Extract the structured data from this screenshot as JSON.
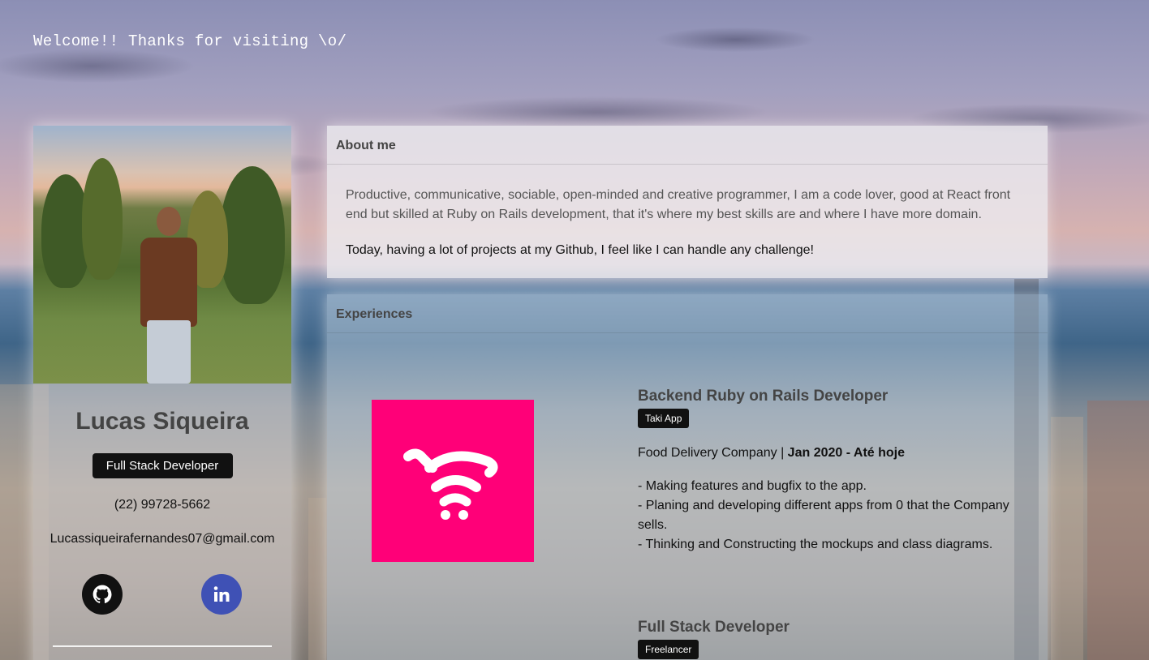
{
  "welcome": "Welcome!! Thanks for visiting \\o/",
  "profile": {
    "name": "Lucas Siqueira",
    "role": "Full Stack Developer",
    "phone": "(22) 99728-5662",
    "email": "Lucassiqueirafernandes07@gmail.com",
    "socials": [
      {
        "icon": "github-icon",
        "color": "#111111"
      },
      {
        "icon": "linkedin-icon",
        "color": "#3f51b5"
      }
    ]
  },
  "about": {
    "title": "About me",
    "paragraph1": "Productive, communicative, sociable, open-minded and creative programmer, I am a code lover, good at React front end but skilled at Ruby on Rails development, that it's where my best skills are and where I have more domain.",
    "paragraph2": "Today, having a lot of projects at my Github, I feel like I can handle any challenge!"
  },
  "experiences": {
    "title": "Experiences",
    "jobs": [
      {
        "title": "Backend Ruby on Rails Developer",
        "tag": "Taki App",
        "company": "Food Delivery Company | ",
        "period": "Jan 2020 - Até hoje",
        "lines": [
          "- Making features and bugfix to the app.",
          "- Planing and developing different apps from 0 that the Company sells.",
          "- Thinking and Constructing the mockups and class diagrams."
        ],
        "logo_color": "#ff0078"
      },
      {
        "title": "Full Stack Developer",
        "tag": "Freelancer"
      }
    ]
  }
}
